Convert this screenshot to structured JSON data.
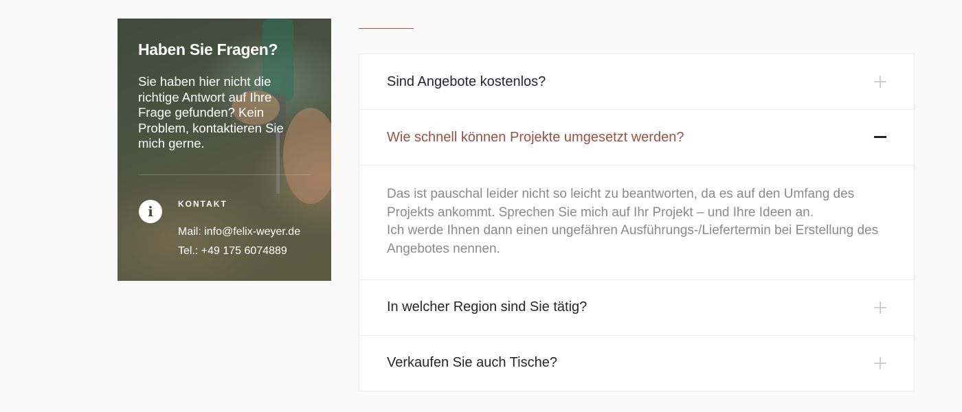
{
  "contact_card": {
    "title": "Haben Sie Fragen?",
    "lead": "Sie haben hier nicht die richtige Antwort auf Ihre Frage gefunden? Kein Problem, kontaktieren Sie mich gerne.",
    "label": "KONTAKT",
    "mail": "Mail: info@felix-weyer.de",
    "tel": "Tel.: +49 175 6074889",
    "icon": "info-icon"
  },
  "faq": {
    "items": [
      {
        "question": "Sind Angebote kostenlos?",
        "expanded": false
      },
      {
        "question": "Wie schnell können Projekte umgesetzt werden?",
        "expanded": true,
        "answer_line_1": "Das ist pauschal leider nicht so leicht zu beantworten, da es auf den Umfang des Projekts ankommt. Sprechen Sie mich auf Ihr Projekt – und Ihre Ideen an.",
        "answer_line_2": "Ich werde Ihnen dann einen ungefähren Ausführungs-/Liefertermin bei Erstellung des Angebotes nennen."
      },
      {
        "question": "In welcher Region sind Sie tätig?",
        "expanded": false
      },
      {
        "question": "Verkaufen Sie auch Tische?",
        "expanded": false
      }
    ]
  },
  "colors": {
    "accent": "#9a5242",
    "heading": "#25232e",
    "body_text": "#8a8a8a",
    "border": "#ebebeb"
  }
}
